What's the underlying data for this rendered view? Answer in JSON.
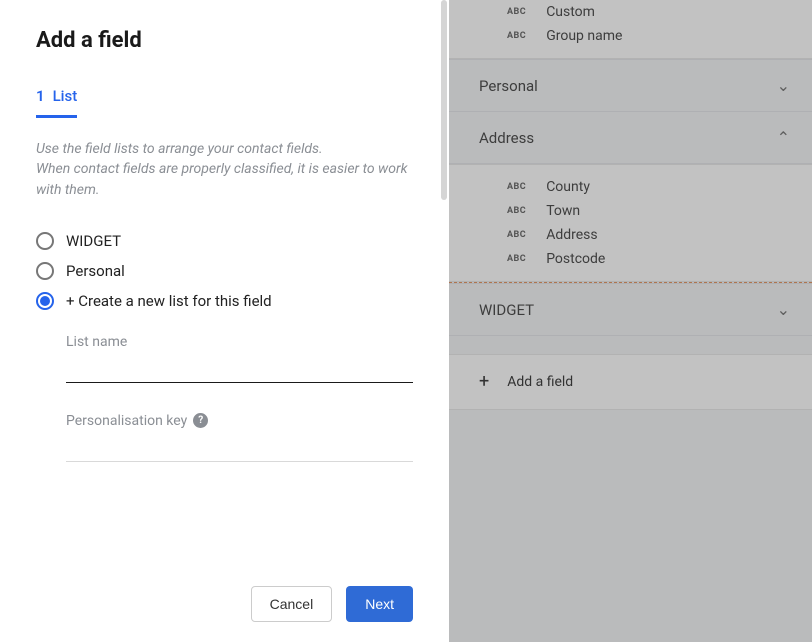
{
  "modal": {
    "title": "Add a field",
    "tab": {
      "number": "1",
      "label": "List"
    },
    "description": "Use the field lists to arrange your contact fields.\nWhen contact fields are properly classified, it is easier to work with them.",
    "radios": {
      "option1": "WIDGET",
      "option2": "Personal",
      "option3": "+ Create a new list for this field"
    },
    "list_name_label": "List name",
    "personalisation_label": "Personalisation key",
    "cancel_label": "Cancel",
    "next_label": "Next"
  },
  "side": {
    "badge": "ABC",
    "top_fields": {
      "custom": "Custom",
      "group_name": "Group name"
    },
    "sections": {
      "personal": "Personal",
      "address": "Address",
      "address_fields": {
        "county": "County",
        "town": "Town",
        "address": "Address",
        "postcode": "Postcode"
      },
      "widget": "WIDGET"
    },
    "add_field_label": "Add a field"
  }
}
